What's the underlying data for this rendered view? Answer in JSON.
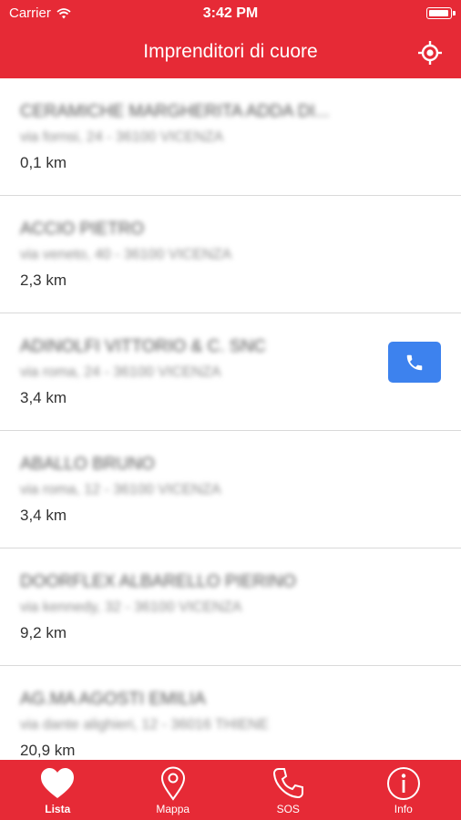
{
  "status_bar": {
    "carrier": "Carrier",
    "time": "3:42 PM",
    "battery_level": 0.95
  },
  "nav": {
    "title": "Imprenditori di cuore",
    "locate_icon": "location-target-icon"
  },
  "list": {
    "items": [
      {
        "name": "CERAMICHE MARGHERITA ADDA DI...",
        "address": "via fornsi, 24 - 36100 VICENZA",
        "distance": "0,1 km",
        "has_call": false
      },
      {
        "name": "ACCIO PIETRO",
        "address": "via veneto, 40 - 36100 VICENZA",
        "distance": "2,3 km",
        "has_call": false
      },
      {
        "name": "ADINOLFI VITTORIO & C. SNC",
        "address": "via roma, 24 - 36100 VICENZA",
        "distance": "3,4 km",
        "has_call": true
      },
      {
        "name": "ABALLO BRUNO",
        "address": "via roma, 12 - 36100 VICENZA",
        "distance": "3,4 km",
        "has_call": false
      },
      {
        "name": "DOORFLEX ALBARELLO PIERINO",
        "address": "via kennedy, 32 - 36100 VICENZA",
        "distance": "9,2 km",
        "has_call": false
      },
      {
        "name": "AG.MA AGOSTI EMILIA",
        "address": "via dante alighieri, 12 - 36016 THIENE",
        "distance": "20,9 km",
        "has_call": false
      }
    ]
  },
  "tabbar": {
    "tabs": [
      {
        "label": "Lista",
        "icon": "heart-icon",
        "active": true
      },
      {
        "label": "Mappa",
        "icon": "map-pin-icon",
        "active": false
      },
      {
        "label": "SOS",
        "icon": "phone-icon",
        "active": false
      },
      {
        "label": "Info",
        "icon": "info-icon",
        "active": false
      }
    ]
  },
  "colors": {
    "brand_red": "#e62a36",
    "call_blue": "#3d82ee"
  }
}
